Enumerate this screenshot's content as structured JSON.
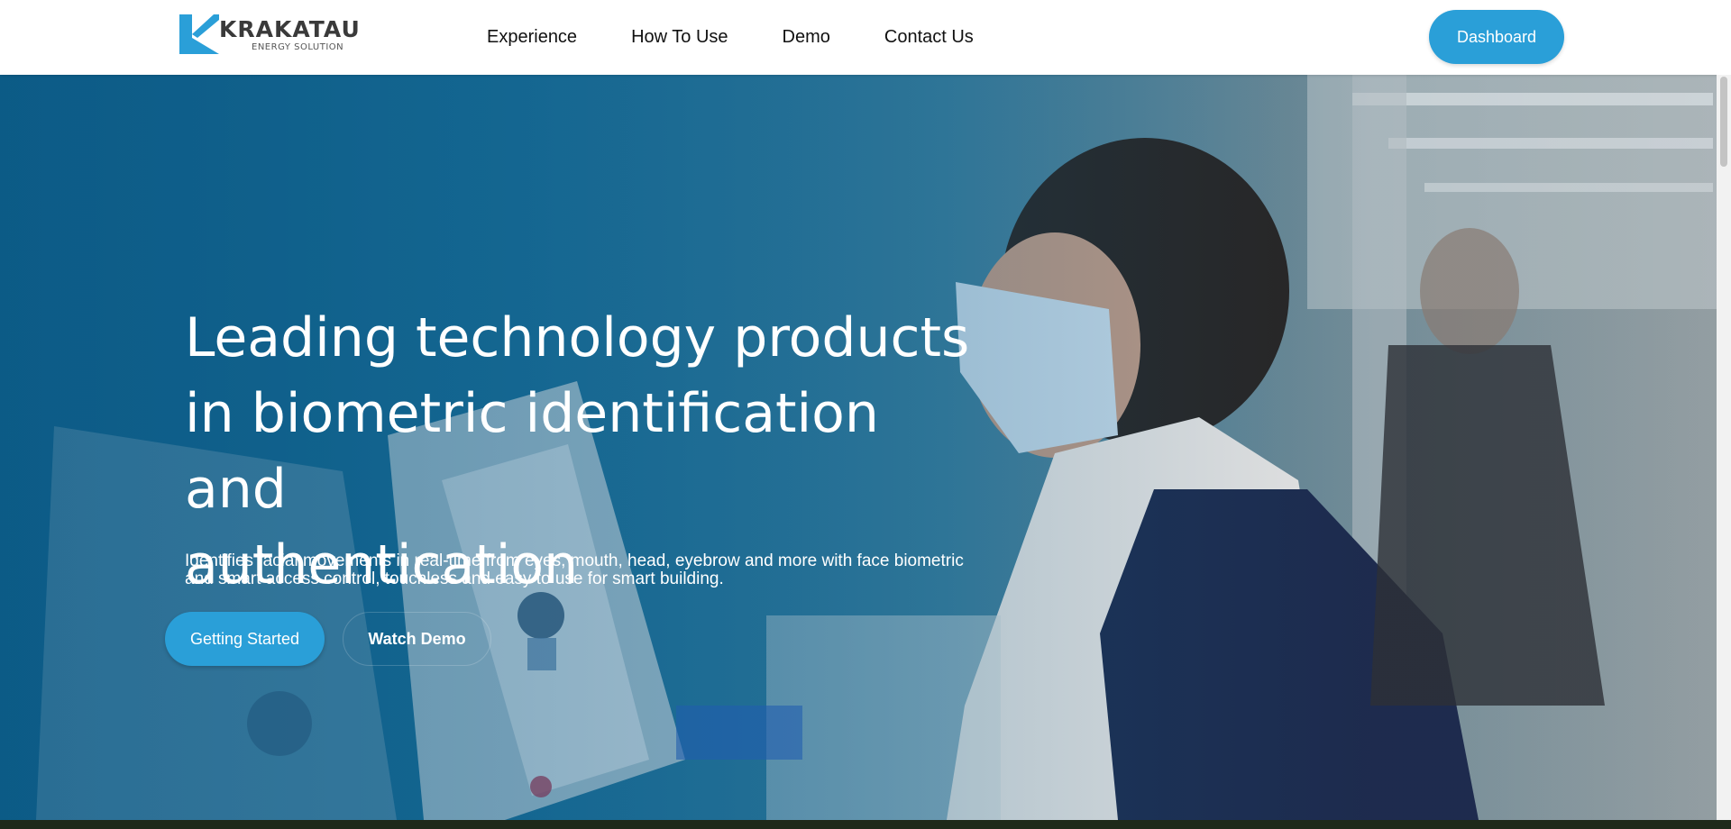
{
  "header": {
    "logo": {
      "brand": "KRAKATAU",
      "subtitle": "ENERGY SOLUTION"
    },
    "nav": [
      {
        "label": "Experience"
      },
      {
        "label": "How To Use"
      },
      {
        "label": "Demo"
      },
      {
        "label": "Contact Us"
      }
    ],
    "dashboard_label": "Dashboard"
  },
  "hero": {
    "title_line1": "Leading technology products",
    "title_line2": "in biometric identification and",
    "title_line3": "authentication",
    "description": "Identifies facial movements in real-time from eyes, mouth, head, eyebrow and more with face biometric and smart access control, touchless and easy to use for smart building.",
    "primary_button": "Getting Started",
    "secondary_button": "Watch Demo"
  },
  "colors": {
    "accent": "#2a9fd8",
    "hero_tint": "#0f5c86"
  }
}
